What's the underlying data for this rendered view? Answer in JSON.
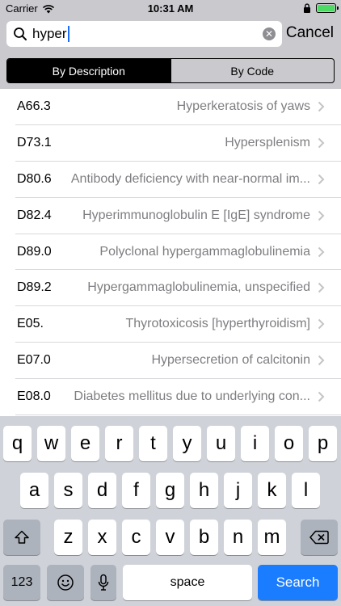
{
  "status_bar": {
    "carrier": "Carrier",
    "time": "10:31 AM"
  },
  "search": {
    "query": "hyper",
    "cancel_label": "Cancel"
  },
  "segments": {
    "by_description": "By Description",
    "by_code": "By Code",
    "selected": "By Description"
  },
  "results": [
    {
      "code": "A66.3",
      "description": "Hyperkeratosis of yaws"
    },
    {
      "code": "D73.1",
      "description": "Hypersplenism"
    },
    {
      "code": "D80.6",
      "description": "Antibody deficiency with near-normal im..."
    },
    {
      "code": "D82.4",
      "description": "Hyperimmunoglobulin E [IgE] syndrome"
    },
    {
      "code": "D89.0",
      "description": "Polyclonal hypergammaglobulinemia"
    },
    {
      "code": "D89.2",
      "description": "Hypergammaglobulinemia, unspecified"
    },
    {
      "code": "E05.",
      "description": "Thyrotoxicosis [hyperthyroidism]"
    },
    {
      "code": "E07.0",
      "description": "Hypersecretion of calcitonin"
    },
    {
      "code": "E08.0",
      "description": "Diabetes mellitus due to underlying con..."
    }
  ],
  "keyboard": {
    "row1": [
      "q",
      "w",
      "e",
      "r",
      "t",
      "y",
      "u",
      "i",
      "o",
      "p"
    ],
    "row2": [
      "a",
      "s",
      "d",
      "f",
      "g",
      "h",
      "j",
      "k",
      "l"
    ],
    "row3": [
      "z",
      "x",
      "c",
      "v",
      "b",
      "n",
      "m"
    ],
    "numbers_label": "123",
    "space_label": "space",
    "search_label": "Search"
  },
  "colors": {
    "accent": "#1a7cff",
    "battery": "#4cd964"
  }
}
